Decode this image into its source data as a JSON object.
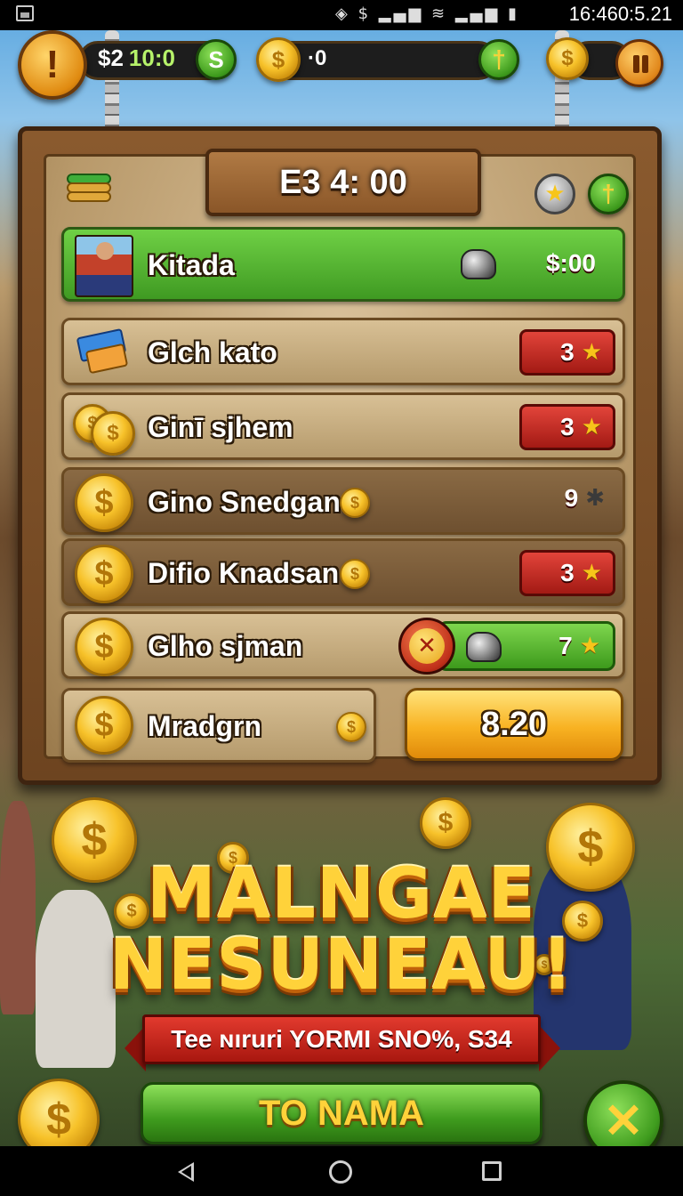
{
  "status_bar": {
    "icons": "◈ $ ▂▄▆ ≋ ▂▄▆ ▮",
    "clock": "16:460:5.21"
  },
  "hud": {
    "cash_label": "$2",
    "cash_timer": "10:0",
    "cash_badge": "S",
    "coin_count": "·0",
    "add_glyph": "†",
    "coin_glyph": "$"
  },
  "board": {
    "title": "E3 4: 00",
    "star_glyph": "★",
    "add_glyph": "†"
  },
  "rows": [
    {
      "label": "Kitada",
      "value": "$:00"
    },
    {
      "label": "Glch kato",
      "value": "3"
    },
    {
      "label": "Ginī sjhem",
      "value": "3"
    },
    {
      "label": "Gino Snedgan",
      "value": "9"
    },
    {
      "label": "Difio Knadsan",
      "value": "3"
    },
    {
      "label": "Glho sjman",
      "value": "7"
    },
    {
      "label": "Mradgrn",
      "value": "8.20"
    }
  ],
  "glyphs": {
    "star": "★",
    "gear": "✱",
    "x": "✕",
    "coin": "$"
  },
  "promo": {
    "title_line1": "MALNGAE",
    "title_line2": "NESUNEAU!",
    "ribbon": "Tee ɴıruri YORMI SNO%, S34",
    "go_button": "TO NAMA",
    "close_glyph": "✕"
  },
  "colors": {
    "accent_green": "#3f9c1e",
    "accent_red": "#c0301a",
    "gold": "#f7c22a",
    "wood": "#6d4420"
  }
}
